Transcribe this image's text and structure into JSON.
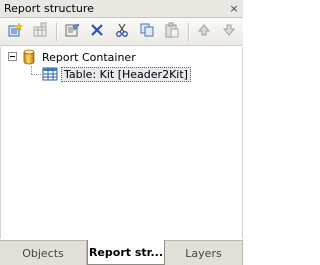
{
  "panel": {
    "title": "Report structure",
    "close_symbol": "×"
  },
  "toolbar": {
    "buttons": [
      {
        "name": "new-item-icon",
        "enabled": true
      },
      {
        "name": "new-group-icon",
        "enabled": false
      },
      {
        "name": "properties-icon",
        "enabled": true
      },
      {
        "name": "delete-icon",
        "enabled": true
      },
      {
        "name": "cut-icon",
        "enabled": true
      },
      {
        "name": "copy-icon",
        "enabled": true
      },
      {
        "name": "paste-icon",
        "enabled": false
      },
      {
        "name": "move-up-icon",
        "enabled": false
      },
      {
        "name": "move-down-icon",
        "enabled": false
      }
    ]
  },
  "tree": {
    "root": {
      "label": "Report Container",
      "icon": "cylinder-icon",
      "expanded": true
    },
    "child": {
      "label": "Table: Kit [Header2Kit]",
      "icon": "table-icon",
      "selected": true
    }
  },
  "tabs": [
    {
      "label": "Objects",
      "active": false
    },
    {
      "label": "Report str...",
      "active": true
    },
    {
      "label": "Layers",
      "active": false
    }
  ],
  "colors": {
    "accent": "#316ac5",
    "toolbar_bg": "#ebe9e2",
    "tab_bg": "#e2e0d8"
  }
}
